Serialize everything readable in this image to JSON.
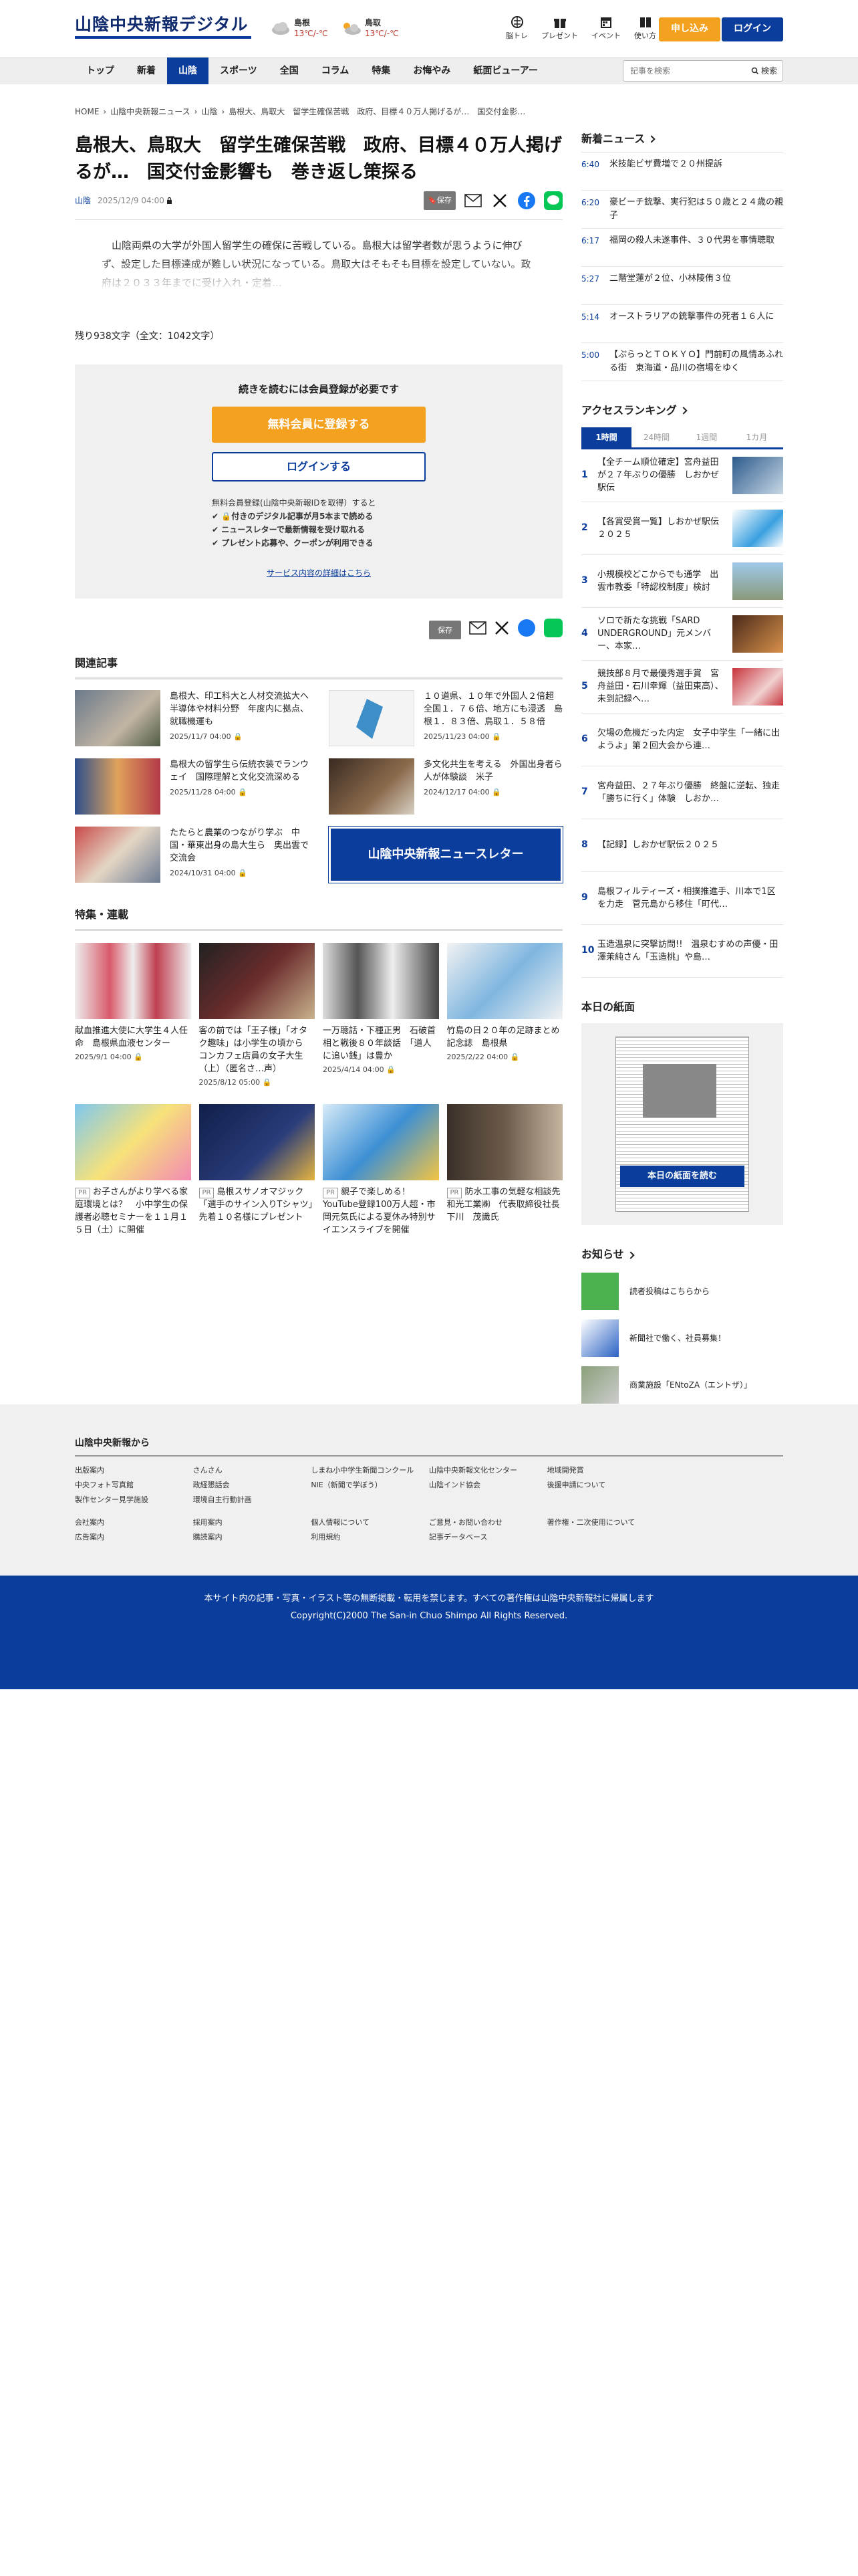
{
  "header": {
    "logo": "山陰中央新報デジタル",
    "subscribe": "申し込み",
    "login": "ログイン",
    "weather": [
      {
        "city": "島根",
        "temp": "13℃/-℃"
      },
      {
        "city": "鳥取",
        "temp": "13℃/-℃"
      }
    ],
    "util": [
      "脳トレ",
      "プレゼント",
      "イベント",
      "使い方"
    ]
  },
  "nav": {
    "items": [
      "トップ",
      "新着",
      "山陰",
      "スポーツ",
      "全国",
      "コラム",
      "特集",
      "お悔やみ",
      "紙面ビューアー"
    ],
    "active": 2,
    "search_placeholder": "記事を検索",
    "search_btn": "検索"
  },
  "article": {
    "breadcrumb": [
      "HOME",
      "›",
      "山陰中央新報ニュース",
      "›",
      "山陰",
      "›",
      "島根大、鳥取大　留学生確保苦戦　政府、目標４０万人掲げるが…　国交付金影…"
    ],
    "title": "島根大、鳥取大　留学生確保苦戦　政府、目標４０万人掲げるが…　国交付金影響も　巻き返し策探る",
    "category": "山陰",
    "date": "2025/12/9 04:00",
    "save": "保存",
    "lead": "山陰両県の大学が外国人留学生の確保に苦戦している。島根大は留学者数が思うように伸びず、設定した目標達成が難しい状況になっている。鳥取大はそもそも目標を設定していない。政府は２０３３年までに受け入れ・定着…",
    "remaining": "残り938文字（全文：1042文字）"
  },
  "gate": {
    "title": "続きを読むには会員登録が必要です",
    "register": "無料会員に登録する",
    "login": "ログインする",
    "benefits_title": "無料会員登録(山陰中央新報IDを取得）すると",
    "benefits": [
      "付きのデジタル記事が月5本まで読める",
      "ニュースレターで最新情報を受け取れる",
      "プレゼント応募や、クーポンが利用できる"
    ],
    "link": "サービス内容の詳細はこちら"
  },
  "related": {
    "title": "関連記事",
    "items": [
      {
        "title": "島根大、印工科大と人材交流拡大へ　半導体や材料分野　年度内に拠点、就職機運も",
        "date": "2025/11/7 04:00"
      },
      {
        "title": "１０道県、１０年で外国人２倍超　全国１．７６倍、地方にも浸透　島根１．８３倍、鳥取１．５８倍",
        "date": "2025/11/23 04:00"
      },
      {
        "title": "島根大の留学生ら伝統衣装でランウェイ　国際理解と文化交流深める",
        "date": "2025/11/28 04:00"
      },
      {
        "title": "多文化共生を考える　外国出身者ら人が体験談　米子",
        "date": "2024/12/17 04:00"
      },
      {
        "title": "たたらと農業のつながり学ぶ　中国・華東出身の島大生ら　奥出雲で交流会",
        "date": "2024/10/31 04:00"
      },
      {
        "banner": "山陰中央新報ニュースレター"
      }
    ]
  },
  "features": {
    "title": "特集・連載",
    "items": [
      {
        "pr": false,
        "title": "献血推進大使に大学生４人任命　島根県血液センター",
        "date": "2025/9/1 04:00"
      },
      {
        "pr": false,
        "title": "客の前では「王子様」「オタク趣味」は小学生の頃から　コンカフェ店員の女子大生（上）（匿名さ…声）",
        "date": "2025/8/12 05:00"
      },
      {
        "pr": false,
        "title": "一万聴話・下種正男　石破首相と戦後８０年談話　「道人に追い銭」は豊か",
        "date": "2025/4/14 04:00"
      },
      {
        "pr": false,
        "title": "竹島の日２０年の足跡まとめ記念誌　島根県",
        "date": "2025/2/22 04:00"
      },
      {
        "pr": true,
        "title": "お子さんがより学べる家庭環境とは？　小中学生の保護者必聴セミナーを１１月１５日（土）に開催",
        "date": ""
      },
      {
        "pr": true,
        "title": "島根スサノオマジック「選手のサイン入りTシャツ」先着１０名様にプレゼント",
        "date": ""
      },
      {
        "pr": true,
        "title": "親子で楽しめる！YouTube登録100万人超・市岡元気氏による夏休み特別サイエンスライブを開催",
        "date": ""
      },
      {
        "pr": true,
        "title": "防水工事の気軽な相談先　和光工業㈱　代表取締役社長　下川　茂識氏",
        "date": ""
      }
    ]
  },
  "sidebar": {
    "news_title": "新着ニュース",
    "news": [
      {
        "time": "6:40",
        "title": "米技能ビザ費増で２０州提訴"
      },
      {
        "time": "6:20",
        "title": "豪ビーチ銃撃、実行犯は５０歳と２４歳の親子"
      },
      {
        "time": "6:17",
        "title": "福岡の殺人未遂事件、３０代男を事情聴取"
      },
      {
        "time": "5:27",
        "title": "二階堂蓮が２位、小林陵侑３位"
      },
      {
        "time": "5:14",
        "title": "オーストラリアの銃撃事件の死者１６人に"
      },
      {
        "time": "5:00",
        "title": "【ぷらっとＴＯＫＹＯ】門前町の風情あふれる街　東海道・品川の宿場をゆく"
      }
    ],
    "rank_title": "アクセスランキング",
    "rank_tabs": [
      "1時間",
      "24時間",
      "1週間",
      "1カ月"
    ],
    "ranking": [
      {
        "title": "【全チーム順位確定】宮舟益田が２７年ぶりの優勝　しおかぜ駅伝",
        "img": true
      },
      {
        "title": "【各賞受賞一覧】しおかぜ駅伝２０２５",
        "img": true
      },
      {
        "title": "小規模校どこからでも通学　出雲市教委「特認校制度」検討",
        "img": true
      },
      {
        "title": "ソロで新たな挑戦「SARD UNDERGROUND」元メンバー、本家…",
        "img": true
      },
      {
        "title": "競技部８月で最優秀選手賞　宮舟益田・石川幸輝（益田東高）、未到記録へ…",
        "img": true
      },
      {
        "title": "欠場の危機だった内定　女子中学生「一緒に出ようよ」第２回大会から連…",
        "img": false
      },
      {
        "title": "宮舟益田、２７年ぶり優勝　終盤に逆転、独走「勝ちに行く」体験　しおか…",
        "img": false
      },
      {
        "title": "【記録】しおかぜ駅伝２０２５",
        "img": false
      },
      {
        "title": "島根フィルティーズ・相撲推進手、川本で1区を力走　菅元島から移住「町代…",
        "img": false
      },
      {
        "title": "玉造温泉に突撃訪問!!　温泉むすめの声優・田澤茉純さん「玉造桃」や島…",
        "img": false
      }
    ],
    "paper_title": "本日の紙面",
    "paper_btn": "本日の紙面を読む",
    "notice_title": "お知らせ",
    "notices": [
      "読者投稿はこちらから",
      "新聞社で働く、社員募集！",
      "商業施設「ENtoZA（エントザ）」"
    ]
  },
  "footer": {
    "title": "山陰中央新報から",
    "cols": [
      [
        "出版案内",
        "中央フォト写真館",
        "製作センター見学施設"
      ],
      [
        "さんさん",
        "政経懇話会",
        "環境自主行動計画"
      ],
      [
        "しまね小中学生新聞コンクール",
        "NIE（新聞で学ぼう）",
        ""
      ],
      [
        "山陰中央新報文化センター",
        "山陰インド協会",
        ""
      ],
      [
        "地域開発賞",
        "後援申請について",
        ""
      ],
      [
        "",
        "",
        ""
      ]
    ],
    "cols2": [
      [
        "会社案内",
        "広告案内"
      ],
      [
        "採用案内",
        "購読案内"
      ],
      [
        "個人情報について",
        "利用規約"
      ],
      [
        "ご意見・お問い合わせ",
        "記事データベース"
      ],
      [
        "著作権・二次使用について",
        ""
      ],
      [
        "",
        ""
      ]
    ],
    "copy1": "本サイト内の記事・写真・イラスト等の無断掲載・転用を禁じます。すべての著作権は山陰中央新報社に帰属します",
    "copy2": "Copyright(C)2000 The San-in Chuo Shimpo All Rights Reserved."
  }
}
